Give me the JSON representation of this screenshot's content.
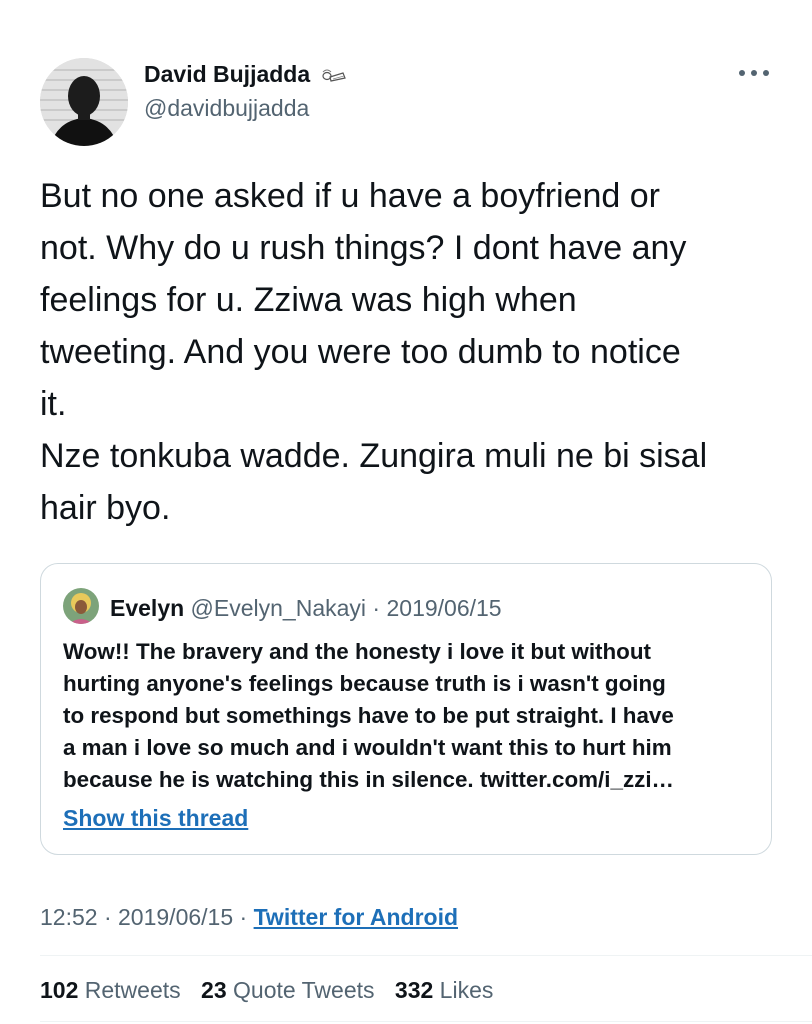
{
  "author": {
    "name": "David Bujjadda",
    "handle": "@davidbujjadda",
    "name_emoji": "reclining-figure-emoji"
  },
  "tweet": {
    "text": "But no one asked if u have a boyfriend or\nnot. Why do u rush things? I dont have any\nfeelings for u. Zziwa was high when\ntweeting. And you were too dumb to notice\nit.\nNze tonkuba wadde. Zungira muli ne bi sisal\nhair byo."
  },
  "quoted": {
    "name": "Evelyn",
    "handle": "@Evelyn_Nakayi",
    "separator": "·",
    "date": "2019/06/15",
    "text": "Wow!! The bravery and the honesty i love it but without\nhurting anyone's feelings because truth is i wasn't going\nto respond but somethings have to be put straight. I have\na man i love so much and i wouldn't want this to hurt him\nbecause he is watching this in silence. twitter.com/i_zzi…",
    "show_thread": "Show this thread"
  },
  "meta": {
    "time": "12:52",
    "separator": "·",
    "date": "2019/06/15",
    "client": "Twitter for Android"
  },
  "stats": {
    "retweets_count": "102",
    "retweets_label": "Retweets",
    "quotes_count": "23",
    "quotes_label": "Quote Tweets",
    "likes_count": "332",
    "likes_label": "Likes"
  },
  "colors": {
    "text": "#0f1419",
    "secondary": "#536471",
    "link": "#1d6fb8",
    "border": "#cfd9de"
  },
  "icons": {
    "more": "more-horizontal-icon"
  }
}
